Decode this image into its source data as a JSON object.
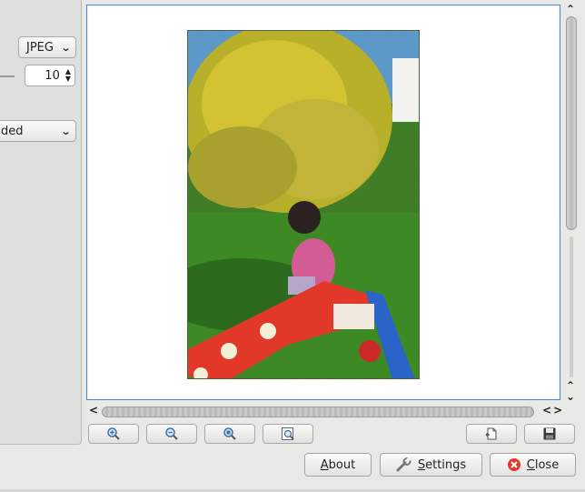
{
  "left_panel": {
    "format_combo": "JPEG",
    "quality_spin": "10",
    "mode_combo_partial": "ded"
  },
  "buttons": {
    "about": {
      "mnemonic": "A",
      "rest": "bout"
    },
    "settings": {
      "mnemonic": "S",
      "rest": "ettings"
    },
    "close": {
      "mnemonic": "C",
      "rest": "lose"
    }
  },
  "toolbar": {
    "items": [
      "zoom-in-icon",
      "zoom-out-icon",
      "zoom-to-selection-icon",
      "zoom-fit-icon",
      "rotate-icon",
      "save-icon"
    ]
  },
  "colors": {
    "focus_border": "#4b88c7",
    "close_icon": "#e03a2a"
  }
}
